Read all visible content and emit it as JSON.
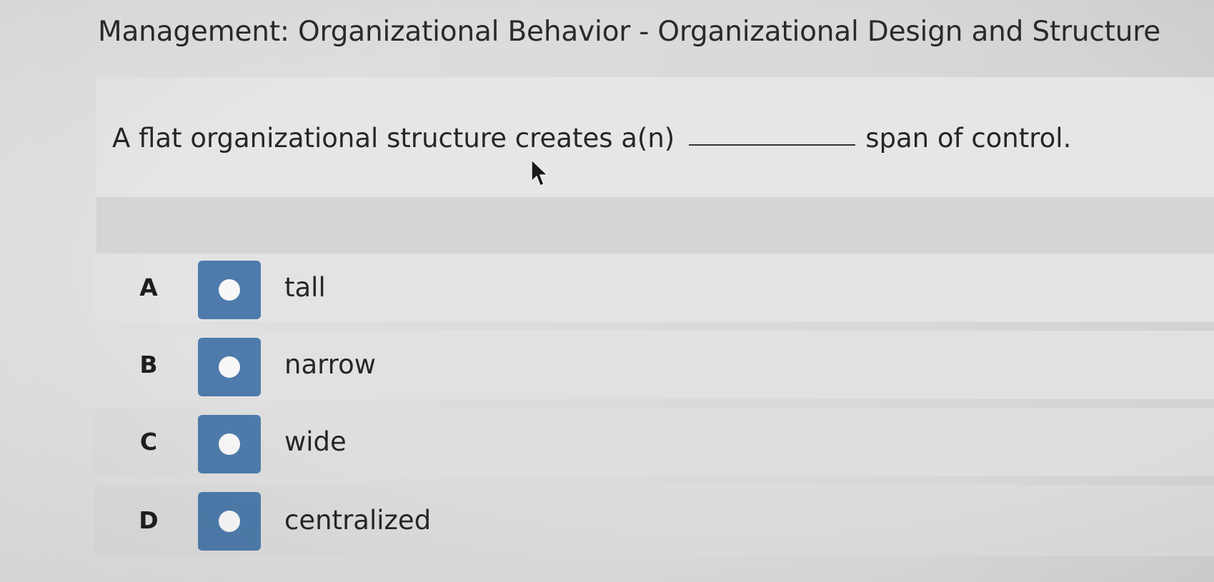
{
  "page": {
    "title": "Management: Organizational Behavior - Organizational Design and Structure"
  },
  "question": {
    "text_before": "A flat organizational structure creates a(n)",
    "text_after": "span of control."
  },
  "options": [
    {
      "letter": "A",
      "label": "tall",
      "selected": false
    },
    {
      "letter": "B",
      "label": "narrow",
      "selected": false
    },
    {
      "letter": "C",
      "label": "wide",
      "selected": false
    },
    {
      "letter": "D",
      "label": "centralized",
      "selected": false
    }
  ],
  "colors": {
    "radio_box": "#4e7bab",
    "radio_dot": "#f7f7f7"
  },
  "icons": {
    "cursor": "mouse-pointer-icon"
  }
}
